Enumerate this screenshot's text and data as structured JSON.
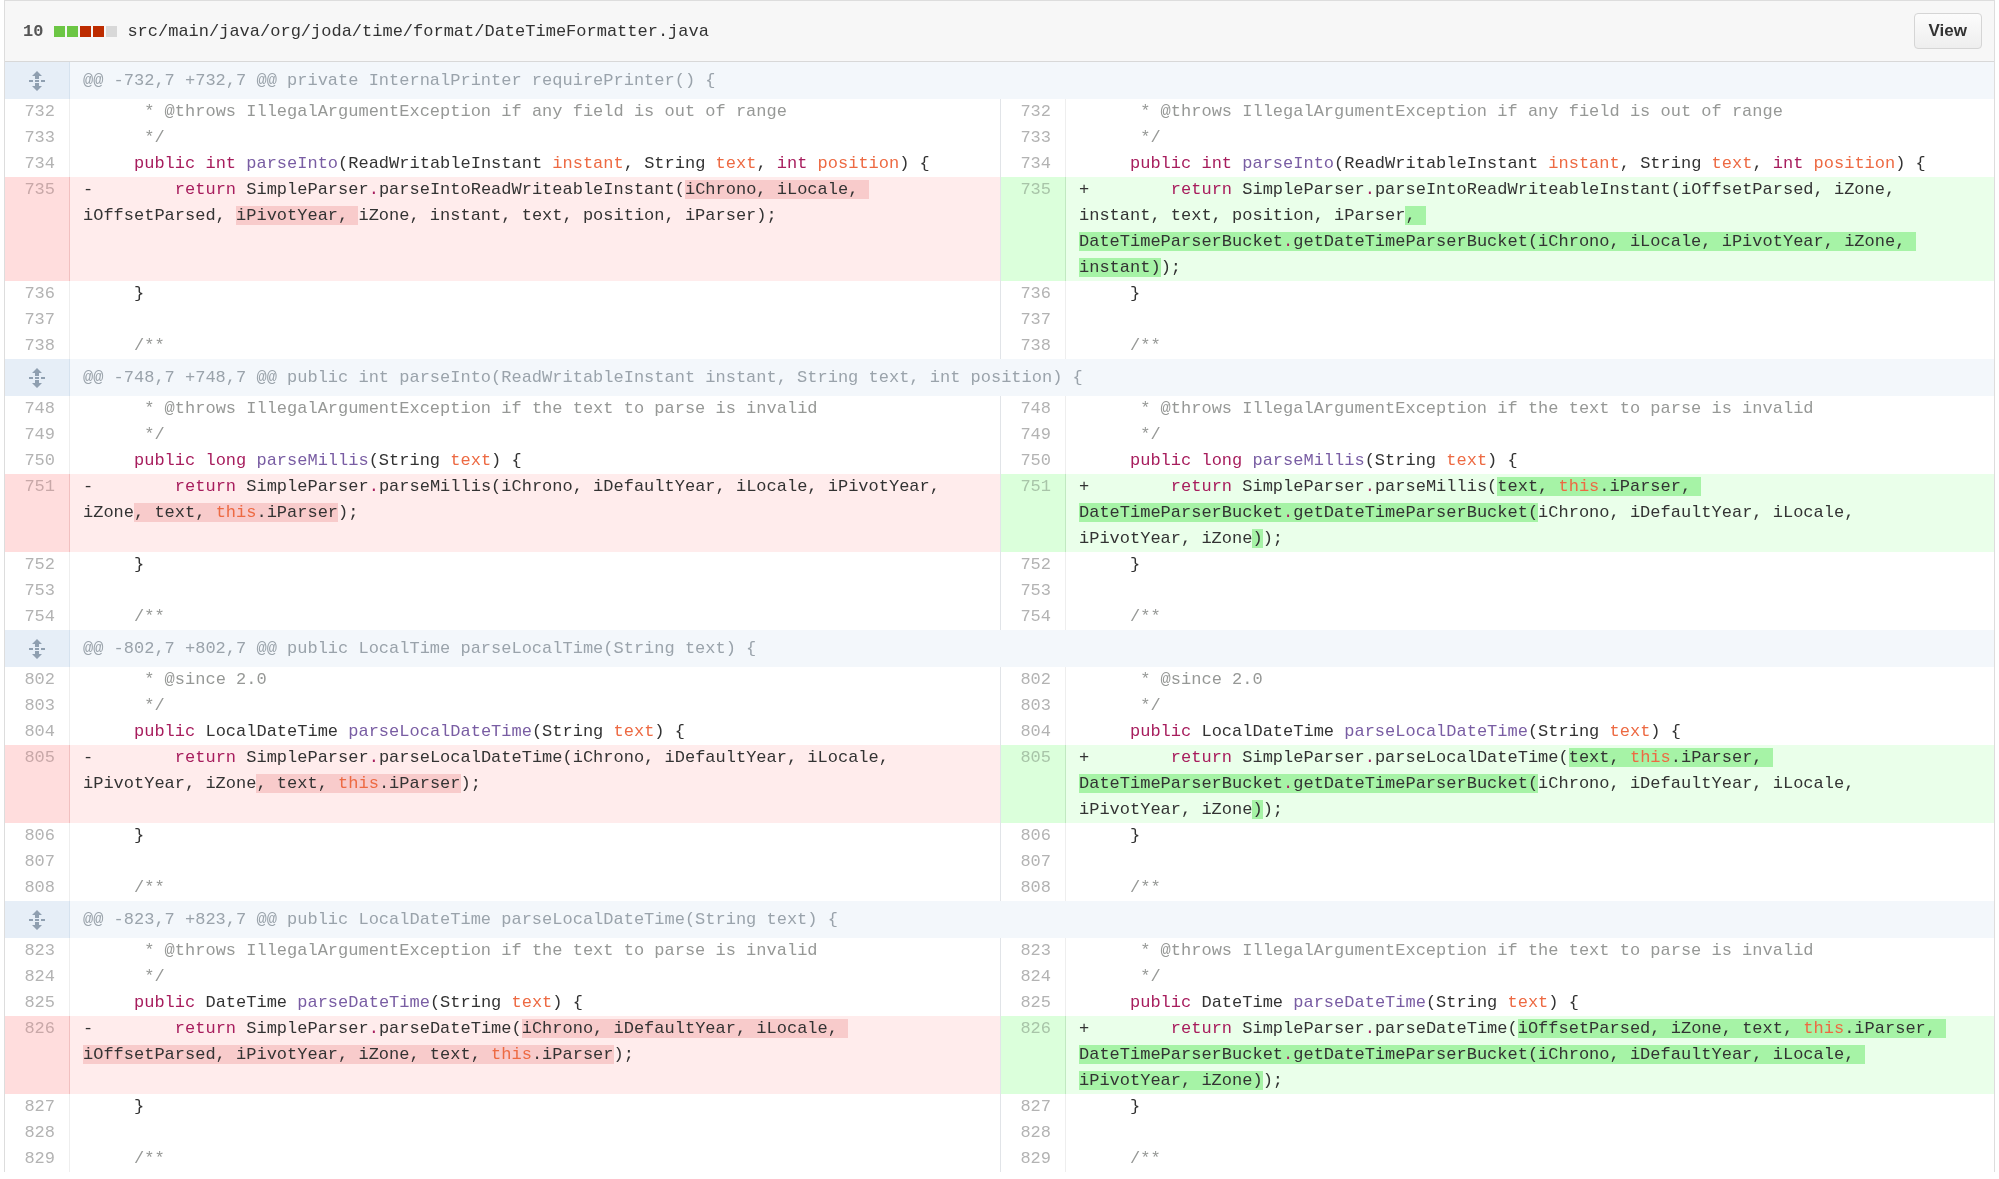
{
  "file": {
    "changes": "10",
    "diffstat": [
      {
        "color": "#6cc644"
      },
      {
        "color": "#6cc644"
      },
      {
        "color": "#bd2c00"
      },
      {
        "color": "#bd2c00"
      },
      {
        "color": "#d8d8d8"
      }
    ],
    "path": "src/main/java/org/joda/time/format/DateTimeFormatter.java",
    "view_button": "View"
  },
  "hunks": [
    {
      "header": "@@ -732,7 +732,7 @@ private InternalPrinter requirePrinter() {",
      "rows": [
        {
          "left": {
            "number": "732",
            "kind": "context",
            "segments": [
              {
                "text": "      * @throws IllegalArgumentException if any field is out of range",
                "kind": "comment",
                "marked": false
              }
            ]
          },
          "right": {
            "number": "732",
            "kind": "context",
            "segments": [
              {
                "text": "      * @throws IllegalArgumentException if any field is out of range",
                "kind": "comment",
                "marked": false
              }
            ]
          }
        },
        {
          "left": {
            "number": "733",
            "kind": "context",
            "segments": [
              {
                "text": "      */",
                "kind": "comment",
                "marked": false
              }
            ]
          },
          "right": {
            "number": "733",
            "kind": "context",
            "segments": [
              {
                "text": "      */",
                "kind": "comment",
                "marked": false
              }
            ]
          }
        },
        {
          "left": {
            "number": "734",
            "kind": "context",
            "segments": [
              {
                "text": "     public int ",
                "kind": "keyword",
                "marked": false
              },
              {
                "text": "parseInto",
                "kind": "entity",
                "marked": false
              },
              {
                "text": "(ReadWritableInstant ",
                "kind": "plain",
                "marked": false
              },
              {
                "text": "instant",
                "kind": "variable",
                "marked": false
              },
              {
                "text": ", String ",
                "kind": "plain",
                "marked": false
              },
              {
                "text": "text",
                "kind": "variable",
                "marked": false
              },
              {
                "text": ", ",
                "kind": "plain",
                "marked": false
              },
              {
                "text": "int",
                "kind": "keyword",
                "marked": false
              },
              {
                "text": " position",
                "kind": "variable",
                "marked": false
              },
              {
                "text": ") {",
                "kind": "plain",
                "marked": false
              }
            ]
          },
          "right": {
            "number": "734",
            "kind": "context",
            "segments": [
              {
                "text": "     public int ",
                "kind": "keyword",
                "marked": false
              },
              {
                "text": "parseInto",
                "kind": "entity",
                "marked": false
              },
              {
                "text": "(ReadWritableInstant ",
                "kind": "plain",
                "marked": false
              },
              {
                "text": "instant",
                "kind": "variable",
                "marked": false
              },
              {
                "text": ", String ",
                "kind": "plain",
                "marked": false
              },
              {
                "text": "text",
                "kind": "variable",
                "marked": false
              },
              {
                "text": ", ",
                "kind": "plain",
                "marked": false
              },
              {
                "text": "int",
                "kind": "keyword",
                "marked": false
              },
              {
                "text": " position",
                "kind": "variable",
                "marked": false
              },
              {
                "text": ") {",
                "kind": "plain",
                "marked": false
              }
            ]
          }
        },
        {
          "left": {
            "number": "735",
            "kind": "deleted",
            "segments": [
              {
                "text": "-        ",
                "kind": "plain",
                "marked": false
              },
              {
                "text": "return",
                "kind": "keyword",
                "marked": false
              },
              {
                "text": " SimpleParser",
                "kind": "plain",
                "marked": false
              },
              {
                "text": ".",
                "kind": "keyword",
                "marked": false
              },
              {
                "text": "parseIntoReadWriteableInstant(",
                "kind": "plain",
                "marked": false
              },
              {
                "text": "iChrono, iLocale, ",
                "kind": "plain",
                "marked": true
              },
              {
                "text": "iOffsetParsed, ",
                "kind": "plain",
                "marked": false
              },
              {
                "text": "iPivotYear, ",
                "kind": "plain",
                "marked": true
              },
              {
                "text": "iZone, instant, text, position, iParser);",
                "kind": "plain",
                "marked": false
              }
            ]
          },
          "right": {
            "number": "735",
            "kind": "added",
            "segments": [
              {
                "text": "+        ",
                "kind": "plain",
                "marked": false
              },
              {
                "text": "return",
                "kind": "keyword",
                "marked": false
              },
              {
                "text": " SimpleParser",
                "kind": "plain",
                "marked": false
              },
              {
                "text": ".",
                "kind": "keyword",
                "marked": false
              },
              {
                "text": "parseIntoReadWriteableInstant(iOffsetParsed, iZone, instant, text, position, iParser",
                "kind": "plain",
                "marked": false
              },
              {
                "text": ", DateTimeParserBucket",
                "kind": "plain",
                "marked": true
              },
              {
                "text": ".",
                "kind": "keyword",
                "marked": true
              },
              {
                "text": "getDateTimeParserBucket(iChrono, iLocale, iPivotYear, iZone, instant)",
                "kind": "plain",
                "marked": true
              },
              {
                "text": ");",
                "kind": "plain",
                "marked": false
              }
            ]
          }
        },
        {
          "left": {
            "number": "736",
            "kind": "context",
            "segments": [
              {
                "text": "     }",
                "kind": "plain",
                "marked": false
              }
            ]
          },
          "right": {
            "number": "736",
            "kind": "context",
            "segments": [
              {
                "text": "     }",
                "kind": "plain",
                "marked": false
              }
            ]
          }
        },
        {
          "left": {
            "number": "737",
            "kind": "context"
          },
          "right": {
            "number": "737",
            "kind": "context"
          }
        },
        {
          "left": {
            "number": "738",
            "kind": "context",
            "segments": [
              {
                "text": "     /**",
                "kind": "comment",
                "marked": false
              }
            ]
          },
          "right": {
            "number": "738",
            "kind": "context",
            "segments": [
              {
                "text": "     /**",
                "kind": "comment",
                "marked": false
              }
            ]
          }
        }
      ]
    },
    {
      "header": "@@ -748,7 +748,7 @@ public int parseInto(ReadWritableInstant instant, String text, int position) {",
      "rows": [
        {
          "left": {
            "number": "748",
            "kind": "context",
            "segments": [
              {
                "text": "      * @throws IllegalArgumentException if the text to parse is invalid",
                "kind": "comment",
                "marked": false
              }
            ]
          },
          "right": {
            "number": "748",
            "kind": "context",
            "segments": [
              {
                "text": "      * @throws IllegalArgumentException if the text to parse is invalid",
                "kind": "comment",
                "marked": false
              }
            ]
          }
        },
        {
          "left": {
            "number": "749",
            "kind": "context",
            "segments": [
              {
                "text": "      */",
                "kind": "comment",
                "marked": false
              }
            ]
          },
          "right": {
            "number": "749",
            "kind": "context",
            "segments": [
              {
                "text": "      */",
                "kind": "comment",
                "marked": false
              }
            ]
          }
        },
        {
          "left": {
            "number": "750",
            "kind": "context",
            "segments": [
              {
                "text": "     public long ",
                "kind": "keyword",
                "marked": false
              },
              {
                "text": "parseMillis",
                "kind": "entity",
                "marked": false
              },
              {
                "text": "(String ",
                "kind": "plain",
                "marked": false
              },
              {
                "text": "text",
                "kind": "variable",
                "marked": false
              },
              {
                "text": ") {",
                "kind": "plain",
                "marked": false
              }
            ]
          },
          "right": {
            "number": "750",
            "kind": "context",
            "segments": [
              {
                "text": "     public long ",
                "kind": "keyword",
                "marked": false
              },
              {
                "text": "parseMillis",
                "kind": "entity",
                "marked": false
              },
              {
                "text": "(String ",
                "kind": "plain",
                "marked": false
              },
              {
                "text": "text",
                "kind": "variable",
                "marked": false
              },
              {
                "text": ") {",
                "kind": "plain",
                "marked": false
              }
            ]
          }
        },
        {
          "left": {
            "number": "751",
            "kind": "deleted",
            "segments": [
              {
                "text": "-        ",
                "kind": "plain",
                "marked": false
              },
              {
                "text": "return",
                "kind": "keyword",
                "marked": false
              },
              {
                "text": " SimpleParser",
                "kind": "plain",
                "marked": false
              },
              {
                "text": ".",
                "kind": "keyword",
                "marked": false
              },
              {
                "text": "parseMillis(iChrono, iDefaultYear, iLocale, iPivotYear, iZone",
                "kind": "plain",
                "marked": false
              },
              {
                "text": ", text, ",
                "kind": "plain",
                "marked": true
              },
              {
                "text": "this",
                "kind": "variable",
                "marked": true
              },
              {
                "text": ".iParser",
                "kind": "plain",
                "marked": true
              },
              {
                "text": ");",
                "kind": "plain",
                "marked": false
              }
            ]
          },
          "right": {
            "number": "751",
            "kind": "added",
            "segments": [
              {
                "text": "+        ",
                "kind": "plain",
                "marked": false
              },
              {
                "text": "return",
                "kind": "keyword",
                "marked": false
              },
              {
                "text": " SimpleParser",
                "kind": "plain",
                "marked": false
              },
              {
                "text": ".",
                "kind": "keyword",
                "marked": false
              },
              {
                "text": "parseMillis(",
                "kind": "plain",
                "marked": false
              },
              {
                "text": "text, ",
                "kind": "plain",
                "marked": true
              },
              {
                "text": "this",
                "kind": "variable",
                "marked": true
              },
              {
                "text": ".iParser, DateTimeParserBucket",
                "kind": "plain",
                "marked": true
              },
              {
                "text": ".",
                "kind": "keyword",
                "marked": true
              },
              {
                "text": "getDateTimeParserBucket(",
                "kind": "plain",
                "marked": true
              },
              {
                "text": "iChrono, iDefaultYear, iLocale, iPivotYear, iZone",
                "kind": "plain",
                "marked": false
              },
              {
                "text": ")",
                "kind": "plain",
                "marked": true
              },
              {
                "text": ");",
                "kind": "plain",
                "marked": false
              }
            ]
          }
        },
        {
          "left": {
            "number": "752",
            "kind": "context",
            "segments": [
              {
                "text": "     }",
                "kind": "plain",
                "marked": false
              }
            ]
          },
          "right": {
            "number": "752",
            "kind": "context",
            "segments": [
              {
                "text": "     }",
                "kind": "plain",
                "marked": false
              }
            ]
          }
        },
        {
          "left": {
            "number": "753",
            "kind": "context"
          },
          "right": {
            "number": "753",
            "kind": "context"
          }
        },
        {
          "left": {
            "number": "754",
            "kind": "context",
            "segments": [
              {
                "text": "     /**",
                "kind": "comment",
                "marked": false
              }
            ]
          },
          "right": {
            "number": "754",
            "kind": "context",
            "segments": [
              {
                "text": "     /**",
                "kind": "comment",
                "marked": false
              }
            ]
          }
        }
      ]
    },
    {
      "header": "@@ -802,7 +802,7 @@ public LocalTime parseLocalTime(String text) {",
      "rows": [
        {
          "left": {
            "number": "802",
            "kind": "context",
            "segments": [
              {
                "text": "      * @since 2.0",
                "kind": "comment",
                "marked": false
              }
            ]
          },
          "right": {
            "number": "802",
            "kind": "context",
            "segments": [
              {
                "text": "      * @since 2.0",
                "kind": "comment",
                "marked": false
              }
            ]
          }
        },
        {
          "left": {
            "number": "803",
            "kind": "context",
            "segments": [
              {
                "text": "      */",
                "kind": "comment",
                "marked": false
              }
            ]
          },
          "right": {
            "number": "803",
            "kind": "context",
            "segments": [
              {
                "text": "      */",
                "kind": "comment",
                "marked": false
              }
            ]
          }
        },
        {
          "left": {
            "number": "804",
            "kind": "context",
            "segments": [
              {
                "text": "     public",
                "kind": "keyword",
                "marked": false
              },
              {
                "text": " LocalDateTime ",
                "kind": "plain",
                "marked": false
              },
              {
                "text": "parseLocalDateTime",
                "kind": "entity",
                "marked": false
              },
              {
                "text": "(String ",
                "kind": "plain",
                "marked": false
              },
              {
                "text": "text",
                "kind": "variable",
                "marked": false
              },
              {
                "text": ") {",
                "kind": "plain",
                "marked": false
              }
            ]
          },
          "right": {
            "number": "804",
            "kind": "context",
            "segments": [
              {
                "text": "     public",
                "kind": "keyword",
                "marked": false
              },
              {
                "text": " LocalDateTime ",
                "kind": "plain",
                "marked": false
              },
              {
                "text": "parseLocalDateTime",
                "kind": "entity",
                "marked": false
              },
              {
                "text": "(String ",
                "kind": "plain",
                "marked": false
              },
              {
                "text": "text",
                "kind": "variable",
                "marked": false
              },
              {
                "text": ") {",
                "kind": "plain",
                "marked": false
              }
            ]
          }
        },
        {
          "left": {
            "number": "805",
            "kind": "deleted",
            "segments": [
              {
                "text": "-        ",
                "kind": "plain",
                "marked": false
              },
              {
                "text": "return",
                "kind": "keyword",
                "marked": false
              },
              {
                "text": " SimpleParser",
                "kind": "plain",
                "marked": false
              },
              {
                "text": ".",
                "kind": "keyword",
                "marked": false
              },
              {
                "text": "parseLocalDateTime(iChrono, iDefaultYear, iLocale, iPivotYear, iZone",
                "kind": "plain",
                "marked": false
              },
              {
                "text": ", text, ",
                "kind": "plain",
                "marked": true
              },
              {
                "text": "this",
                "kind": "variable",
                "marked": true
              },
              {
                "text": ".iParser",
                "kind": "plain",
                "marked": true
              },
              {
                "text": ");",
                "kind": "plain",
                "marked": false
              }
            ]
          },
          "right": {
            "number": "805",
            "kind": "added",
            "segments": [
              {
                "text": "+        ",
                "kind": "plain",
                "marked": false
              },
              {
                "text": "return",
                "kind": "keyword",
                "marked": false
              },
              {
                "text": " SimpleParser",
                "kind": "plain",
                "marked": false
              },
              {
                "text": ".",
                "kind": "keyword",
                "marked": false
              },
              {
                "text": "parseLocalDateTime(",
                "kind": "plain",
                "marked": false
              },
              {
                "text": "text, ",
                "kind": "plain",
                "marked": true
              },
              {
                "text": "this",
                "kind": "variable",
                "marked": true
              },
              {
                "text": ".iParser, DateTimeParserBucket",
                "kind": "plain",
                "marked": true
              },
              {
                "text": ".",
                "kind": "keyword",
                "marked": true
              },
              {
                "text": "getDateTimeParserBucket(",
                "kind": "plain",
                "marked": true
              },
              {
                "text": "iChrono, iDefaultYear, iLocale, iPivotYear, iZone",
                "kind": "plain",
                "marked": false
              },
              {
                "text": ")",
                "kind": "plain",
                "marked": true
              },
              {
                "text": ");",
                "kind": "plain",
                "marked": false
              }
            ]
          }
        },
        {
          "left": {
            "number": "806",
            "kind": "context",
            "segments": [
              {
                "text": "     }",
                "kind": "plain",
                "marked": false
              }
            ]
          },
          "right": {
            "number": "806",
            "kind": "context",
            "segments": [
              {
                "text": "     }",
                "kind": "plain",
                "marked": false
              }
            ]
          }
        },
        {
          "left": {
            "number": "807",
            "kind": "context"
          },
          "right": {
            "number": "807",
            "kind": "context"
          }
        },
        {
          "left": {
            "number": "808",
            "kind": "context",
            "segments": [
              {
                "text": "     /**",
                "kind": "comment",
                "marked": false
              }
            ]
          },
          "right": {
            "number": "808",
            "kind": "context",
            "segments": [
              {
                "text": "     /**",
                "kind": "comment",
                "marked": false
              }
            ]
          }
        }
      ]
    },
    {
      "header": "@@ -823,7 +823,7 @@ public LocalDateTime parseLocalDateTime(String text) {",
      "rows": [
        {
          "left": {
            "number": "823",
            "kind": "context",
            "segments": [
              {
                "text": "      * @throws IllegalArgumentException if the text to parse is invalid",
                "kind": "comment",
                "marked": false
              }
            ]
          },
          "right": {
            "number": "823",
            "kind": "context",
            "segments": [
              {
                "text": "      * @throws IllegalArgumentException if the text to parse is invalid",
                "kind": "comment",
                "marked": false
              }
            ]
          }
        },
        {
          "left": {
            "number": "824",
            "kind": "context",
            "segments": [
              {
                "text": "      */",
                "kind": "comment",
                "marked": false
              }
            ]
          },
          "right": {
            "number": "824",
            "kind": "context",
            "segments": [
              {
                "text": "      */",
                "kind": "comment",
                "marked": false
              }
            ]
          }
        },
        {
          "left": {
            "number": "825",
            "kind": "context",
            "segments": [
              {
                "text": "     public",
                "kind": "keyword",
                "marked": false
              },
              {
                "text": " DateTime ",
                "kind": "plain",
                "marked": false
              },
              {
                "text": "parseDateTime",
                "kind": "entity",
                "marked": false
              },
              {
                "text": "(String ",
                "kind": "plain",
                "marked": false
              },
              {
                "text": "text",
                "kind": "variable",
                "marked": false
              },
              {
                "text": ") {",
                "kind": "plain",
                "marked": false
              }
            ]
          },
          "right": {
            "number": "825",
            "kind": "context",
            "segments": [
              {
                "text": "     public",
                "kind": "keyword",
                "marked": false
              },
              {
                "text": " DateTime ",
                "kind": "plain",
                "marked": false
              },
              {
                "text": "parseDateTime",
                "kind": "entity",
                "marked": false
              },
              {
                "text": "(String ",
                "kind": "plain",
                "marked": false
              },
              {
                "text": "text",
                "kind": "variable",
                "marked": false
              },
              {
                "text": ") {",
                "kind": "plain",
                "marked": false
              }
            ]
          }
        },
        {
          "left": {
            "number": "826",
            "kind": "deleted",
            "segments": [
              {
                "text": "-        ",
                "kind": "plain",
                "marked": false
              },
              {
                "text": "return",
                "kind": "keyword",
                "marked": false
              },
              {
                "text": " SimpleParser",
                "kind": "plain",
                "marked": false
              },
              {
                "text": ".",
                "kind": "keyword",
                "marked": false
              },
              {
                "text": "parseDateTime(",
                "kind": "plain",
                "marked": false
              },
              {
                "text": "iChrono, iDefaultYear, iLocale, iOffsetParsed, iPivotYear, iZone, text, ",
                "kind": "plain",
                "marked": true
              },
              {
                "text": "this",
                "kind": "variable",
                "marked": true
              },
              {
                "text": ".iParser",
                "kind": "plain",
                "marked": true
              },
              {
                "text": ");",
                "kind": "plain",
                "marked": false
              }
            ]
          },
          "right": {
            "number": "826",
            "kind": "added",
            "segments": [
              {
                "text": "+        ",
                "kind": "plain",
                "marked": false
              },
              {
                "text": "return",
                "kind": "keyword",
                "marked": false
              },
              {
                "text": " SimpleParser",
                "kind": "plain",
                "marked": false
              },
              {
                "text": ".",
                "kind": "keyword",
                "marked": false
              },
              {
                "text": "parseDateTime(",
                "kind": "plain",
                "marked": false
              },
              {
                "text": "iOffsetParsed, iZone, text, ",
                "kind": "plain",
                "marked": true
              },
              {
                "text": "this",
                "kind": "variable",
                "marked": true
              },
              {
                "text": ".iParser, DateTimeParserBucket",
                "kind": "plain",
                "marked": true
              },
              {
                "text": ".",
                "kind": "keyword",
                "marked": true
              },
              {
                "text": "getDateTimeParserBucket(iChrono, iDefaultYear, iLocale, iPivotYear, iZone)",
                "kind": "plain",
                "marked": true
              },
              {
                "text": ");",
                "kind": "plain",
                "marked": false
              }
            ]
          }
        },
        {
          "left": {
            "number": "827",
            "kind": "context",
            "segments": [
              {
                "text": "     }",
                "kind": "plain",
                "marked": false
              }
            ]
          },
          "right": {
            "number": "827",
            "kind": "context",
            "segments": [
              {
                "text": "     }",
                "kind": "plain",
                "marked": false
              }
            ]
          }
        },
        {
          "left": {
            "number": "828",
            "kind": "context"
          },
          "right": {
            "number": "828",
            "kind": "context"
          }
        },
        {
          "left": {
            "number": "829",
            "kind": "context",
            "segments": [
              {
                "text": "     /**",
                "kind": "comment",
                "marked": false
              }
            ]
          },
          "right": {
            "number": "829",
            "kind": "context",
            "segments": [
              {
                "text": "     /**",
                "kind": "comment",
                "marked": false
              }
            ]
          }
        }
      ]
    }
  ]
}
